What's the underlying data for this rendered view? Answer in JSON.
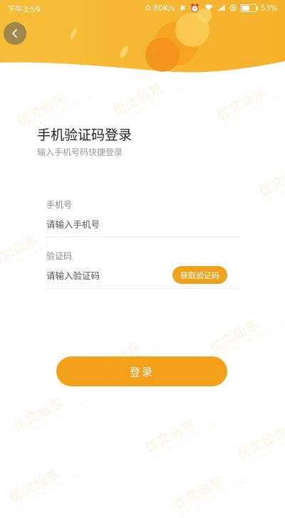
{
  "status_bar": {
    "time": "下午3:59",
    "network_speed": "0.80K/s",
    "battery_percent": "53%",
    "icons": [
      "bluetooth-icon",
      "alarm-icon",
      "wifi-icon",
      "signal-icon",
      "data-saver-icon",
      "battery-icon"
    ]
  },
  "header": {
    "back_icon": "chevron-left-icon",
    "accent_color": "#f6b52e"
  },
  "watermark": {
    "text": "优文仙东",
    "subtext": "YOU WEN XIAN DONG"
  },
  "login": {
    "title": "手机验证码登录",
    "subtitle": "输入手机号码快捷登录",
    "phone_label": "手机号",
    "phone_placeholder": "请输入手机号",
    "phone_value": "",
    "code_label": "验证码",
    "code_placeholder": "请输入验证码",
    "code_value": "",
    "get_code_button": "获取验证码",
    "submit_button": "登录"
  },
  "colors": {
    "primary": "#f3a01a",
    "text": "#222222",
    "muted": "#999999"
  }
}
